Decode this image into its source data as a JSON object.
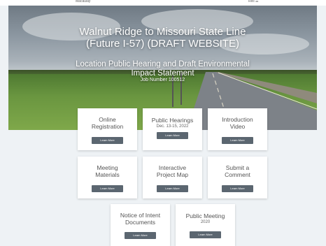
{
  "topbar": {
    "brand": "Macaulay",
    "right": "Reli ☰"
  },
  "hero": {
    "title_line1": "Walnut Ridge to Missouri State Line",
    "title_line2": "(Future I-57) (DRAFT WEBSITE)",
    "subtitle_line1": "Location Public Hearing and Draft Environmental",
    "subtitle_line2": "Impact Statement",
    "job_number": "Job Number 100512"
  },
  "cards": [
    {
      "title_line1": "Online",
      "title_line2": "Registration",
      "date": "",
      "button": "Learn More"
    },
    {
      "title_line1": "Public Hearings",
      "title_line2": "",
      "date": "Dec. 13-15, 2022",
      "button": "Learn More"
    },
    {
      "title_line1": "Introduction",
      "title_line2": "Video",
      "date": "",
      "button": "Learn More"
    },
    {
      "title_line1": "Meeting",
      "title_line2": "Materials",
      "date": "",
      "button": "Learn More"
    },
    {
      "title_line1": "Interactive",
      "title_line2": "Project Map",
      "date": "",
      "button": "Learn More"
    },
    {
      "title_line1": "Submit a",
      "title_line2": "Comment",
      "date": "",
      "button": "Learn More"
    },
    {
      "title_line1": "Notice of Intent",
      "title_line2": "Documents",
      "date": "",
      "button": "Learn More"
    },
    {
      "title_line1": "Public Meeting",
      "title_line2": "",
      "date": "2020",
      "button": "Learn More"
    }
  ]
}
